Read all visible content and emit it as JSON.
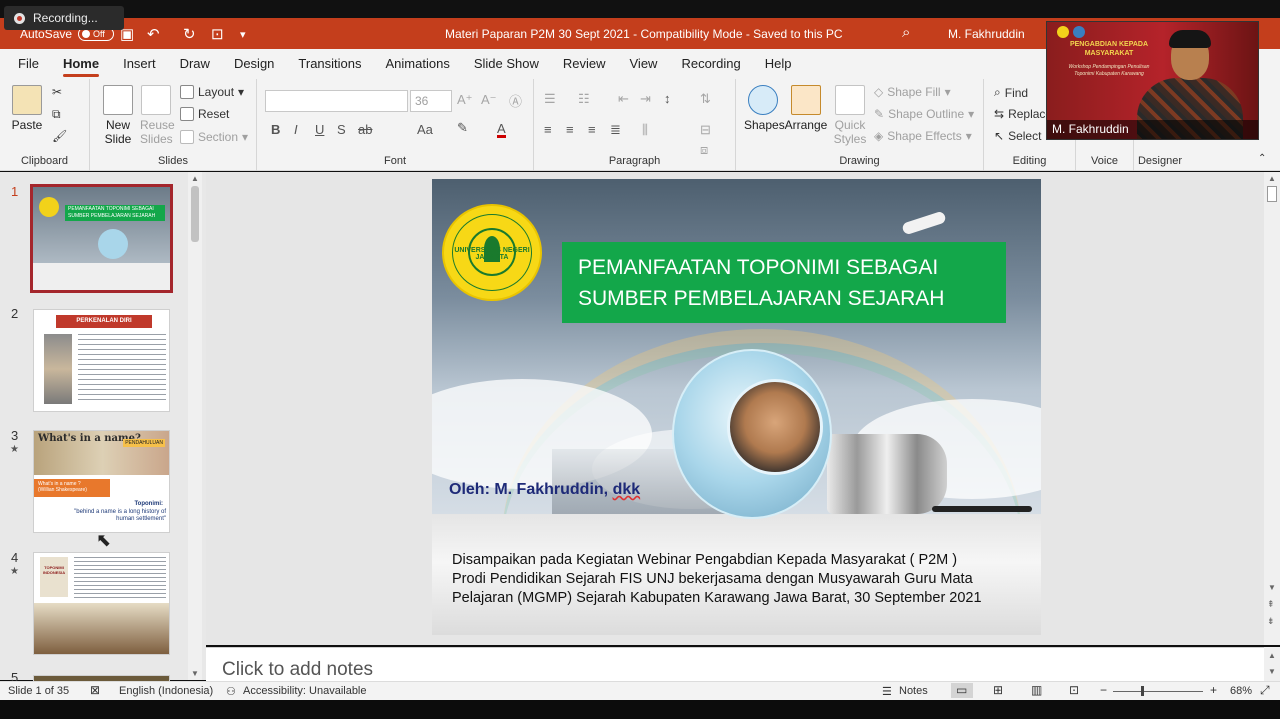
{
  "recording": {
    "label": "Recording..."
  },
  "titlebar": {
    "autosave_label": "AutoSave",
    "autosave_state": "Off",
    "doc_title": "Materi Paparan P2M 30  Sept 2021  -  Compatibility Mode  -  Saved to this PC",
    "user": "M. Fakhruddin"
  },
  "tabs": [
    "File",
    "Home",
    "Insert",
    "Draw",
    "Design",
    "Transitions",
    "Animations",
    "Slide Show",
    "Review",
    "View",
    "Recording",
    "Help"
  ],
  "active_tab": "Home",
  "ribbon": {
    "clipboard": {
      "label": "Clipboard",
      "paste": "Paste"
    },
    "slides": {
      "label": "Slides",
      "new_slide": "New Slide",
      "reuse_slides": "Reuse Slides",
      "layout": "Layout",
      "reset": "Reset",
      "section": "Section"
    },
    "font": {
      "label": "Font",
      "size": "36",
      "bold": "B",
      "italic": "I",
      "underline": "U",
      "strike": "S",
      "spacing": "ab",
      "case": "Aa"
    },
    "paragraph": {
      "label": "Paragraph"
    },
    "drawing": {
      "label": "Drawing",
      "shapes": "Shapes",
      "arrange": "Arrange",
      "quick_styles": "Quick Styles",
      "shape_fill": "Shape Fill",
      "shape_outline": "Shape Outline",
      "shape_effects": "Shape Effects"
    },
    "editing": {
      "label": "Editing",
      "find": "Find",
      "replace": "Replace",
      "select": "Select"
    },
    "voice": {
      "label": "Voice"
    },
    "designer": {
      "label": "Designer"
    }
  },
  "slides_list": [
    {
      "num": "1",
      "star": ""
    },
    {
      "num": "2",
      "star": ""
    },
    {
      "num": "3",
      "star": "★"
    },
    {
      "num": "4",
      "star": "★"
    },
    {
      "num": "5",
      "star": ""
    }
  ],
  "thumbs": {
    "t1_title": "PEMANFAATAN TOPONIMI SEBAGAI SUMBER PEMBELAJARAN SEJARAH",
    "t2_title": "PERKENALAN DIRI",
    "t3_head": "What's in a name?",
    "t3_tag": "PENDAHULUAN",
    "t3_box": "What's in a name ?",
    "t3_box2": "(Willian Shakespeare)",
    "t3_topo": "Toponimi:",
    "t3_quote": "\"behind a name is a long history of human settlement\"",
    "t4_book": "TOPONIMI INDONESIA"
  },
  "slide": {
    "logo_text": "UNIVERSITAS NEGERI JAKARTA",
    "title_line1": "PEMANFAATAN TOPONIMI SEBAGAI",
    "title_line2": "SUMBER PEMBELAJARAN SEJARAH",
    "byline_prefix": "Oleh: M. Fakhruddin, ",
    "byline_dkk": "dkk",
    "desc_line1": "Disampaikan pada Kegiatan Webinar Pengabdian Kepada Masyarakat  ( P2M )",
    "desc_line2": "Prodi Pendidikan Sejarah FIS UNJ bekerjasama dengan Musyawarah Guru Mata",
    "desc_line3": "Pelajaran (MGMP) Sejarah Kabupaten Karawang Jawa Barat,  30 September 2021"
  },
  "notes_placeholder": "Click to add notes",
  "status": {
    "slide_info": "Slide 1 of 35",
    "language": "English (Indonesia)",
    "accessibility": "Accessibility: Unavailable",
    "notes": "Notes",
    "zoom": "68%"
  },
  "video": {
    "name": "M. Fakhruddin",
    "banner": "PENGABDIAN KEPADA MASYARAKAT",
    "sub": "Workshop Pendampingan Penulisan Toponimi Kabupaten Karawang"
  }
}
